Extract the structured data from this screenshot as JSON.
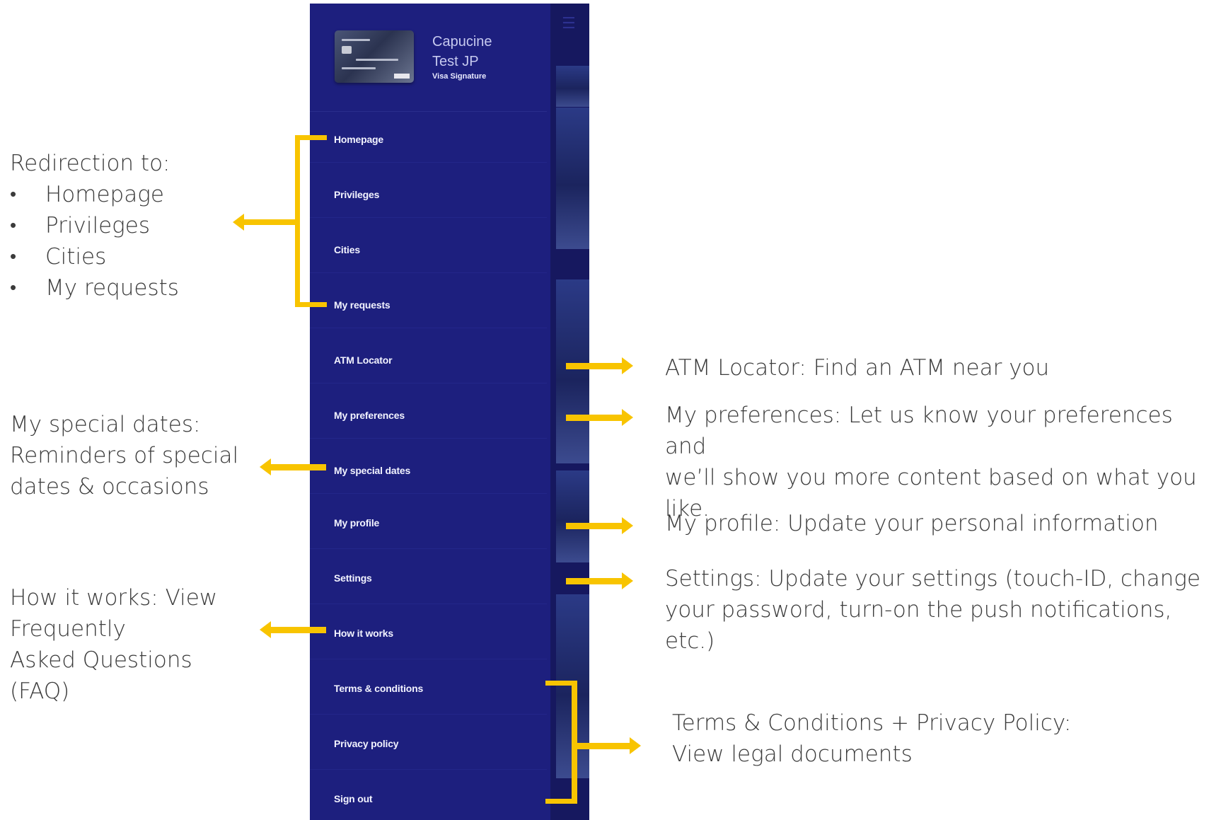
{
  "drawer": {
    "profile": {
      "name_line1": "Capucine",
      "name_line2": "Test JP",
      "card_type": "Visa Signature"
    },
    "menu": [
      {
        "label": "Homepage"
      },
      {
        "label": "Privileges"
      },
      {
        "label": "Cities"
      },
      {
        "label": "My requests"
      },
      {
        "label": "ATM Locator"
      },
      {
        "label": "My preferences"
      },
      {
        "label": "My special dates"
      },
      {
        "label": "My profile"
      },
      {
        "label": "Settings"
      },
      {
        "label": "How it works"
      },
      {
        "label": "Terms & conditions"
      },
      {
        "label": "Privacy policy"
      },
      {
        "label": "Sign out"
      }
    ]
  },
  "annotations": {
    "redirection": {
      "title": "Redirection to:",
      "items": [
        "Homepage",
        "Privileges",
        "Cities",
        "My requests"
      ]
    },
    "special_dates": {
      "line1": "My special dates:",
      "line2": "Reminders of special",
      "line3": "dates & occasions"
    },
    "how_it_works": {
      "line1": "How it works: View",
      "line2": "Frequently",
      "line3": "Asked Questions",
      "line4": "(FAQ)"
    },
    "atm": {
      "line1": "ATM Locator: Find an ATM near you"
    },
    "preferences": {
      "line1": "My preferences: Let us know your preferences and",
      "line2": "we’ll show you more content based on what you",
      "line3": "like."
    },
    "profile": {
      "line1": "My profile: Update your personal information"
    },
    "settings": {
      "line1": "Settings: Update your settings (touch-ID, change",
      "line2": "your password, turn-on the push notifications,",
      "line3": "etc.)"
    },
    "legal": {
      "line1": "Terms & Conditions + Privacy Policy:",
      "line2": "View legal documents"
    }
  },
  "colors": {
    "drawer_bg": "#1d1f7e",
    "accent_arrow": "#f8c400",
    "annotation_text": "#3b3b3b"
  }
}
